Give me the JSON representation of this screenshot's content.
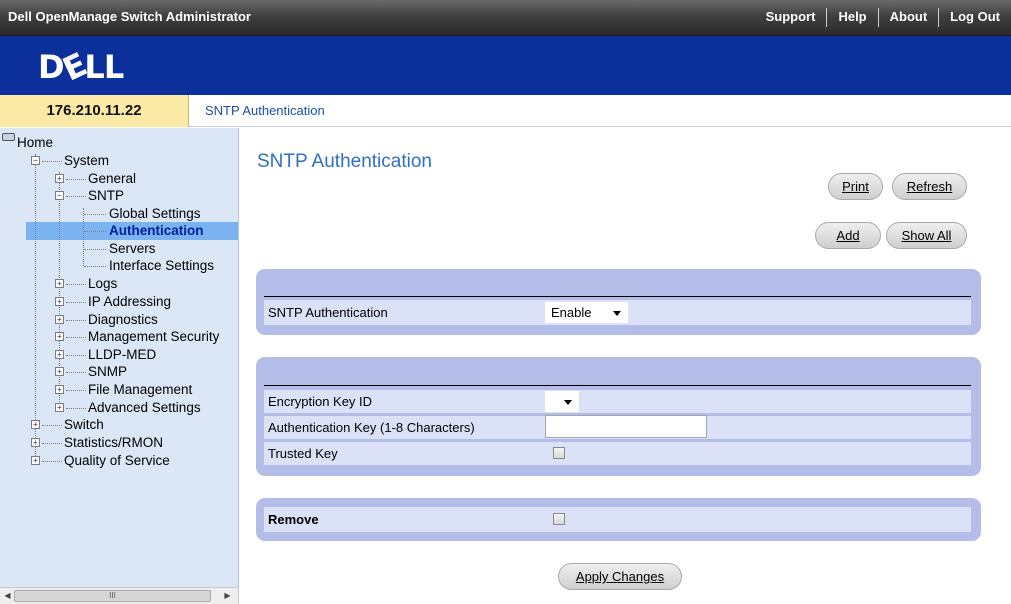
{
  "app": {
    "title": "Dell OpenManage Switch Administrator",
    "logo_text": "DELL"
  },
  "topnav": [
    "Support",
    "Help",
    "About",
    "Log Out"
  ],
  "address": {
    "ip": "176.210.11.22",
    "breadcrumb": "SNTP Authentication"
  },
  "tree": {
    "home": "Home",
    "system": "System",
    "general": "General",
    "sntp": "SNTP",
    "global_settings": "Global Settings",
    "authentication": "Authentication",
    "servers": "Servers",
    "interface_settings": "Interface Settings",
    "logs": "Logs",
    "ip_addressing": "IP Addressing",
    "diagnostics": "Diagnostics",
    "management_security": "Management Security",
    "lldp_med": "LLDP-MED",
    "snmp": "SNMP",
    "file_management": "File Management",
    "advanced_settings": "Advanced Settings",
    "switch": "Switch",
    "statistics_rmon": "Statistics/RMON",
    "quality_of_service": "Quality of Service",
    "selected": "Authentication",
    "scrollbar_grip": "III"
  },
  "main": {
    "title": "SNTP Authentication",
    "buttons": {
      "print": "Print",
      "refresh": "Refresh",
      "add": "Add",
      "show_all": "Show All",
      "apply": "Apply Changes"
    },
    "sntp_auth": {
      "label": "SNTP Authentication",
      "value": "Enable"
    },
    "encryption_key_id": {
      "label": "Encryption Key ID",
      "value": ""
    },
    "auth_key": {
      "label": "Authentication Key (1-8 Characters)",
      "value": ""
    },
    "trusted_key": {
      "label": "Trusted Key",
      "checked": false
    },
    "remove": {
      "label": "Remove",
      "checked": false
    }
  },
  "colors": {
    "banner": "#0b2f9b",
    "panel": "#b4bde7",
    "row": "#dbe2f8",
    "title": "#2f6fc7",
    "tree_bg": "#dbe6f7",
    "selected": "#7ab3ef",
    "ip_box": "#fbe9a6"
  }
}
